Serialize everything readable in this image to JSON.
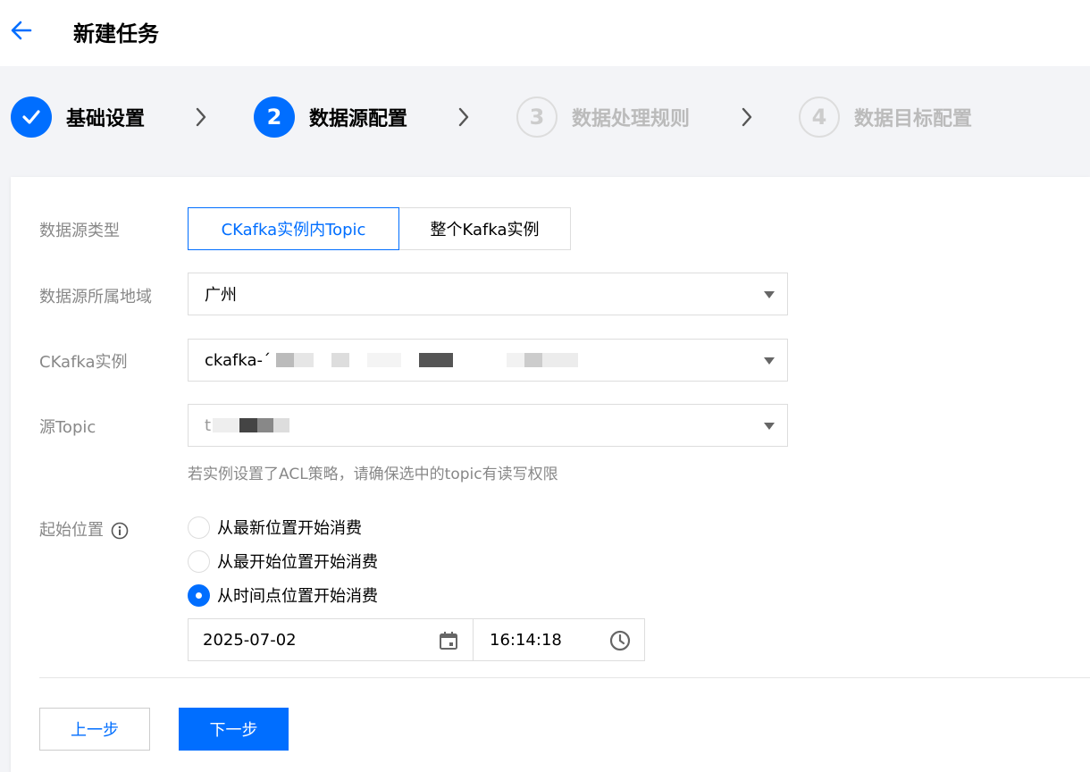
{
  "header": {
    "title": "新建任务"
  },
  "steps": [
    {
      "number": "",
      "label": "基础设置",
      "state": "done"
    },
    {
      "number": "2",
      "label": "数据源配置",
      "state": "active"
    },
    {
      "number": "3",
      "label": "数据处理规则",
      "state": "todo"
    },
    {
      "number": "4",
      "label": "数据目标配置",
      "state": "todo"
    }
  ],
  "form": {
    "source_type": {
      "label": "数据源类型",
      "options": [
        "CKafka实例内Topic",
        "整个Kafka实例"
      ],
      "selected": "CKafka实例内Topic"
    },
    "region": {
      "label": "数据源所属地域",
      "value": "广州"
    },
    "instance": {
      "label": "CKafka实例",
      "value": "ckafka-´"
    },
    "topic": {
      "label": "源Topic",
      "value": "t",
      "hint": "若实例设置了ACL策略，请确保选中的topic有读写权限"
    },
    "start_position": {
      "label": "起始位置",
      "options": [
        "从最新位置开始消费",
        "从最开始位置开始消费",
        "从时间点位置开始消费"
      ],
      "selected_index": 2,
      "date": "2025-07-02",
      "time": "16:14:18"
    }
  },
  "buttons": {
    "prev": "上一步",
    "next": "下一步"
  },
  "colors": {
    "primary": "#006eff",
    "border": "#dddddd",
    "muted": "#888888",
    "background": "#f3f4f7"
  }
}
